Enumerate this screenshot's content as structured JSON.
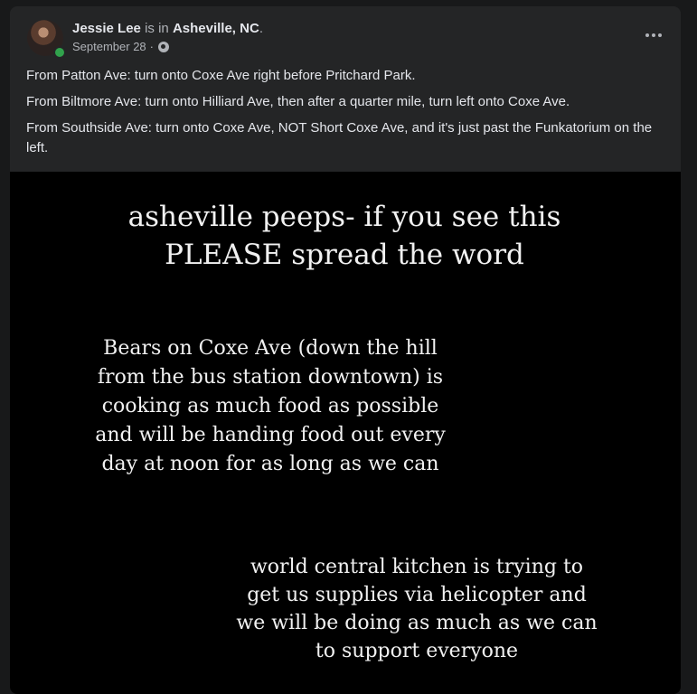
{
  "post": {
    "author": "Jessie Lee",
    "is_in": "is in",
    "location": "Asheville, NC",
    "period": ".",
    "date": "September 28",
    "separator": "·",
    "privacy_icon": "globe-icon",
    "paragraphs": [
      "From Patton Ave: turn onto Coxe Ave right before Pritchard Park.",
      "From Biltmore Ave: turn onto Hilliard Ave, then after a quarter mile, turn left onto Coxe Ave.",
      "From Southside Ave: turn onto Coxe Ave, NOT Short Coxe Ave, and it's just past the Funkatorium on the left."
    ]
  },
  "image": {
    "title": "asheville peeps- if you see this\nPLEASE spread the word",
    "body": "Bears on Coxe Ave (down the hill\nfrom the bus station downtown) is\ncooking as much food as possible\nand will be handing food out every\nday at noon for as long as we can",
    "footer": "world central kitchen is trying to\nget us supplies via helicopter and\nwe will be doing as much as we can\nto support everyone"
  },
  "colors": {
    "page_bg": "#18191a",
    "card_bg": "#242526",
    "primary_text": "#e4e6eb",
    "secondary_text": "#b0b3b8",
    "online": "#31a24c"
  }
}
